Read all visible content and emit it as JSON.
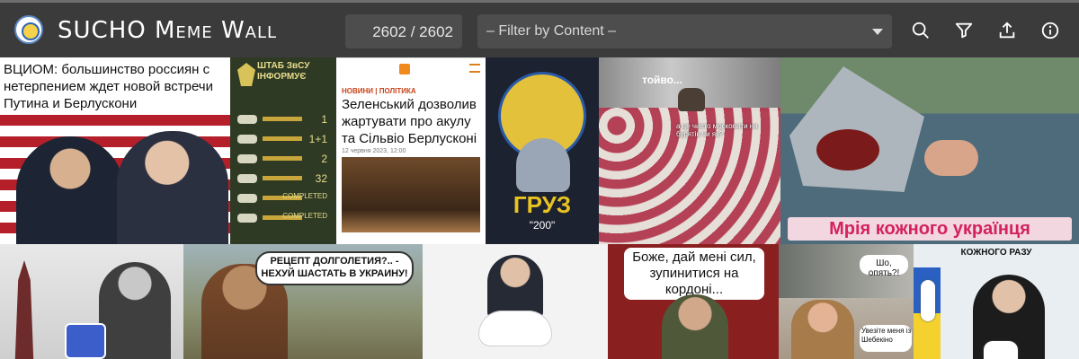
{
  "header": {
    "title": "SUCHO Meme Wall",
    "counter": "2602 / 2602",
    "filter_placeholder": "– Filter by Content –",
    "icons": [
      "search-icon",
      "filter-icon",
      "share-icon",
      "info-icon"
    ]
  },
  "tiles": {
    "t1": {
      "caption": "ВЦИОМ: большинство россиян с нетерпением ждет новой встречи Путина и Берлускони"
    },
    "t2": {
      "caption": "ШТАБ ЗвСУ ІНФОРМУЄ",
      "rows": [
        "1",
        "1+1",
        "2",
        "32",
        "COMPLETED",
        "COMPLETED"
      ]
    },
    "t3": {
      "tag": "НОВИНИ | ПОЛІТИКА",
      "caption": "Зеленський дозволив жартувати про акулу та Сільвіо Берлусконі",
      "date": "12 червня 2023, 12:00"
    },
    "t4": {
      "caption": "ГРУЗ",
      "sub": "\"200\""
    },
    "t5": {
      "caption": "тойво...",
      "note": "а це чисто московити на бурятів чи як?"
    },
    "t6": {
      "caption": "Мрія кожного українця"
    },
    "t8": {
      "caption": "РЕЦЕПТ ДОЛГОЛЕТИЯ?.. - НЕХУЙ ШАСТАТЬ В УКРАИНУ!"
    },
    "t10": {
      "caption": "Боже, дай мені сил, зупинитися на кордоні..."
    },
    "t11": {
      "bubble1": "Шо, опять?!",
      "bubble2": "Увезіте меня із Шебекіно"
    },
    "t12": {
      "caption": "КОЖНОГО РАЗУ"
    }
  },
  "colors": {
    "topbar": "#3b3b3b",
    "accent_red": "#b51f2a",
    "ukraine_blue": "#2a60c2",
    "ukraine_yellow": "#f4d12f"
  }
}
